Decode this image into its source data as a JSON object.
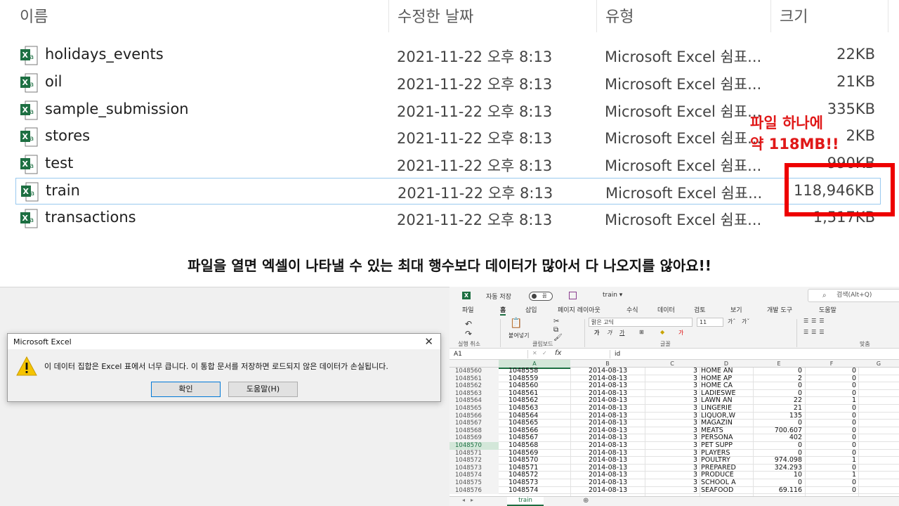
{
  "explorer": {
    "columns": {
      "name": "이름",
      "date": "수정한 날짜",
      "type": "유형",
      "size": "크기"
    },
    "files": [
      {
        "name": "holidays_events",
        "date": "2021-11-22 오후 8:13",
        "type": "Microsoft Excel 쉼표...",
        "size": "22KB"
      },
      {
        "name": "oil",
        "date": "2021-11-22 오후 8:13",
        "type": "Microsoft Excel 쉼표...",
        "size": "21KB"
      },
      {
        "name": "sample_submission",
        "date": "2021-11-22 오후 8:13",
        "type": "Microsoft Excel 쉼표...",
        "size": "335KB"
      },
      {
        "name": "stores",
        "date": "2021-11-22 오후 8:13",
        "type": "Microsoft Excel 쉼표...",
        "size": "2KB"
      },
      {
        "name": "test",
        "date": "2021-11-22 오후 8:13",
        "type": "Microsoft Excel 쉼표...",
        "size": "990KB"
      },
      {
        "name": "train",
        "date": "2021-11-22 오후 8:13",
        "type": "Microsoft Excel 쉼표...",
        "size": "118,946KB"
      },
      {
        "name": "transactions",
        "date": "2021-11-22 오후 8:13",
        "type": "Microsoft Excel 쉼표...",
        "size": "1,517KB"
      }
    ]
  },
  "annotation": {
    "line1": "파일 하나에",
    "line2": "약 118MB!!",
    "color": "#e01818"
  },
  "caption": "파일을 열면 엑셀이 나타낼 수 있는 최대 행수보다 데이터가 많아서 다 나오지를 않아요!!",
  "dialog": {
    "title": "Microsoft Excel",
    "message": "이 데이터 집합은 Excel 표에서 너무 큽니다.  이 통합 문서를 저장하면 로드되지 않은 데이터가 손실됩니다.",
    "ok": "확인",
    "help": "도움말(H)"
  },
  "excel": {
    "autosave": "자동 저장",
    "autosave_state": "끔",
    "doc_name": "train ▾",
    "search": "검색(Alt+Q)",
    "menu": [
      "파일",
      "홈",
      "삽입",
      "페이지 레이아웃",
      "수식",
      "데이터",
      "검토",
      "보기",
      "개발 도구",
      "도움말"
    ],
    "ribbon": {
      "undo_group": "실행 취소",
      "paste": "붙여넣기",
      "clipboard_group": "클립보드",
      "font_name": "맑은 고딕",
      "font_size": "11",
      "font_group": "글꼴",
      "align_group": "맞춤"
    },
    "name_box": "A1",
    "fx": "fx",
    "formula": "id",
    "columns": [
      "A",
      "B",
      "C",
      "D",
      "E",
      "F",
      "G"
    ],
    "rows": [
      {
        "rn": "1048560",
        "a": "1048558",
        "b": "2014-08-13",
        "c": "3",
        "d": "HOME AN",
        "e": "0",
        "f": "0"
      },
      {
        "rn": "1048561",
        "a": "1048559",
        "b": "2014-08-13",
        "c": "3",
        "d": "HOME AP",
        "e": "2",
        "f": "0"
      },
      {
        "rn": "1048562",
        "a": "1048560",
        "b": "2014-08-13",
        "c": "3",
        "d": "HOME CA",
        "e": "0",
        "f": "0"
      },
      {
        "rn": "1048563",
        "a": "1048561",
        "b": "2014-08-13",
        "c": "3",
        "d": "LADIESWE",
        "e": "0",
        "f": "0"
      },
      {
        "rn": "1048564",
        "a": "1048562",
        "b": "2014-08-13",
        "c": "3",
        "d": "LAWN AN",
        "e": "22",
        "f": "1"
      },
      {
        "rn": "1048565",
        "a": "1048563",
        "b": "2014-08-13",
        "c": "3",
        "d": "LINGERIE",
        "e": "21",
        "f": "0"
      },
      {
        "rn": "1048566",
        "a": "1048564",
        "b": "2014-08-13",
        "c": "3",
        "d": "LIQUOR,W",
        "e": "135",
        "f": "0"
      },
      {
        "rn": "1048567",
        "a": "1048565",
        "b": "2014-08-13",
        "c": "3",
        "d": "MAGAZIN",
        "e": "0",
        "f": "0"
      },
      {
        "rn": "1048568",
        "a": "1048566",
        "b": "2014-08-13",
        "c": "3",
        "d": "MEATS",
        "e": "700.607",
        "f": "0"
      },
      {
        "rn": "1048569",
        "a": "1048567",
        "b": "2014-08-13",
        "c": "3",
        "d": "PERSONA",
        "e": "402",
        "f": "0"
      },
      {
        "rn": "1048570",
        "a": "1048568",
        "b": "2014-08-13",
        "c": "3",
        "d": "PET SUPP",
        "e": "0",
        "f": "0"
      },
      {
        "rn": "1048571",
        "a": "1048569",
        "b": "2014-08-13",
        "c": "3",
        "d": "PLAYERS",
        "e": "0",
        "f": "0"
      },
      {
        "rn": "1048572",
        "a": "1048570",
        "b": "2014-08-13",
        "c": "3",
        "d": "POULTRY",
        "e": "974.098",
        "f": "1"
      },
      {
        "rn": "1048573",
        "a": "1048571",
        "b": "2014-08-13",
        "c": "3",
        "d": "PREPARED",
        "e": "324.293",
        "f": "0"
      },
      {
        "rn": "1048574",
        "a": "1048572",
        "b": "2014-08-13",
        "c": "3",
        "d": "PRODUCE",
        "e": "10",
        "f": "1"
      },
      {
        "rn": "1048575",
        "a": "1048573",
        "b": "2014-08-13",
        "c": "3",
        "d": "SCHOOL A",
        "e": "0",
        "f": "0"
      },
      {
        "rn": "1048576",
        "a": "1048574",
        "b": "2014-08-13",
        "c": "3",
        "d": "SEAFOOD",
        "e": "69.116",
        "f": "0"
      }
    ],
    "sheet_tab": "train"
  }
}
